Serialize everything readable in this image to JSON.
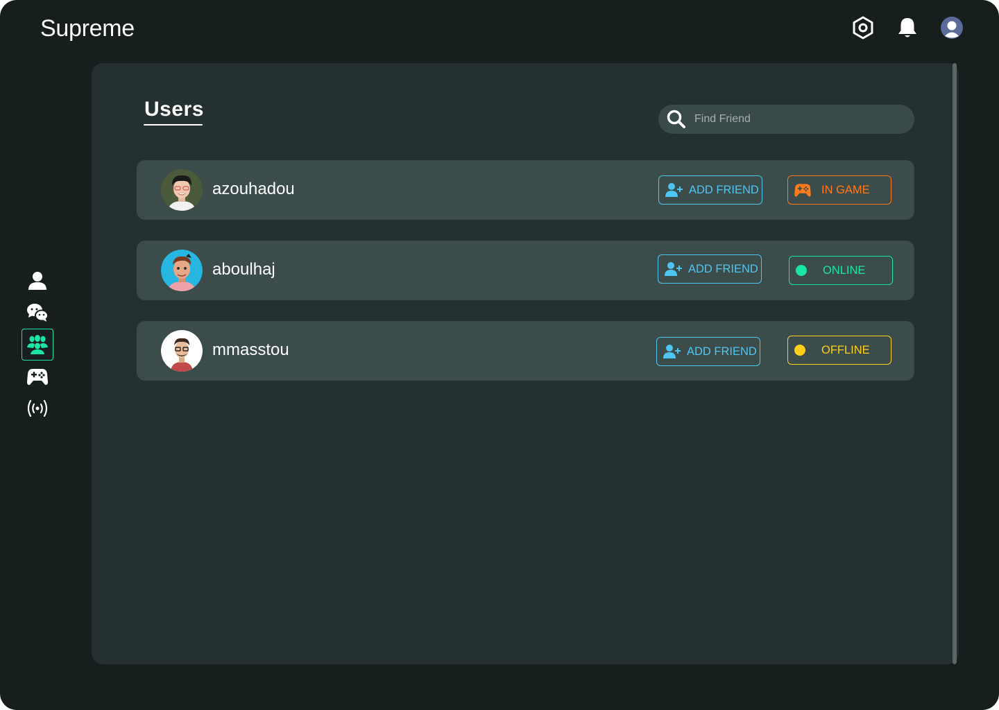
{
  "app": {
    "name": "Supreme"
  },
  "header": {
    "icons": [
      "settings-icon",
      "bell-icon",
      "profile-avatar-icon"
    ]
  },
  "sidebar": {
    "items": [
      {
        "icon": "user-icon",
        "active": false
      },
      {
        "icon": "chat-icon",
        "active": false
      },
      {
        "icon": "users-group-icon",
        "active": true
      },
      {
        "icon": "gamepad-icon",
        "active": false
      },
      {
        "icon": "broadcast-icon",
        "active": false
      }
    ]
  },
  "main": {
    "title": "Users",
    "search": {
      "placeholder": "Find Friend",
      "value": ""
    },
    "users": [
      {
        "name": "azouhadou",
        "action_label": "ADD FRIEND",
        "status": "IN GAME",
        "status_color": "#ff7a1a"
      },
      {
        "name": "aboulhaj",
        "action_label": "ADD FRIEND",
        "status": "ONLINE",
        "status_color": "#19e5a5"
      },
      {
        "name": "mmasstou",
        "action_label": "ADD FRIEND",
        "status": "OFFLINE",
        "status_color": "#ffcf1a"
      }
    ]
  },
  "colors": {
    "background": "#161e1e",
    "panel": "#243130",
    "row": "#3b4c4b",
    "accent": "#19e5a5",
    "link": "#4fc6f2"
  }
}
